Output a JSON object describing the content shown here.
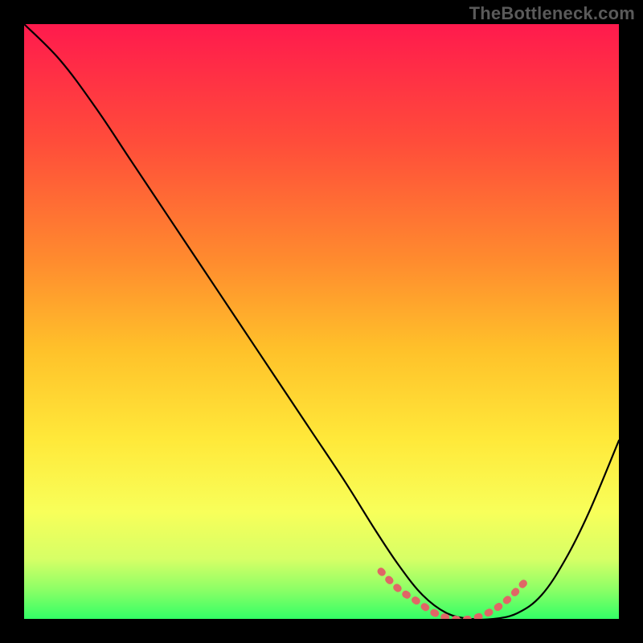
{
  "watermark": "TheBottleneck.com",
  "chart_data": {
    "type": "line",
    "title": "",
    "xlabel": "",
    "ylabel": "",
    "xlim": [
      0,
      100
    ],
    "ylim": [
      0,
      100
    ],
    "grid": false,
    "legend": false,
    "series": [
      {
        "name": "curve",
        "color": "#000000",
        "x": [
          0,
          6,
          12,
          18,
          24,
          30,
          36,
          42,
          48,
          54,
          59,
          63,
          67,
          71,
          75,
          79,
          83,
          87,
          91,
          95,
          100
        ],
        "values": [
          100,
          94,
          86,
          77,
          68,
          59,
          50,
          41,
          32,
          23,
          15,
          9,
          4,
          1,
          0,
          0,
          1,
          4,
          10,
          18,
          30
        ]
      },
      {
        "name": "highlight-band",
        "color": "#e06666",
        "x": [
          60,
          63,
          66,
          69,
          72,
          75,
          78,
          81,
          84
        ],
        "values": [
          8,
          5,
          3,
          1,
          0,
          0,
          1,
          3,
          6
        ]
      }
    ],
    "gradient_stops": [
      {
        "offset": 0.0,
        "color": "#ff1a4d"
      },
      {
        "offset": 0.2,
        "color": "#ff4d3a"
      },
      {
        "offset": 0.4,
        "color": "#ff8c2e"
      },
      {
        "offset": 0.55,
        "color": "#ffc22a"
      },
      {
        "offset": 0.7,
        "color": "#ffe93a"
      },
      {
        "offset": 0.82,
        "color": "#f8ff5a"
      },
      {
        "offset": 0.9,
        "color": "#d6ff66"
      },
      {
        "offset": 0.95,
        "color": "#8dff66"
      },
      {
        "offset": 1.0,
        "color": "#33ff66"
      }
    ]
  }
}
